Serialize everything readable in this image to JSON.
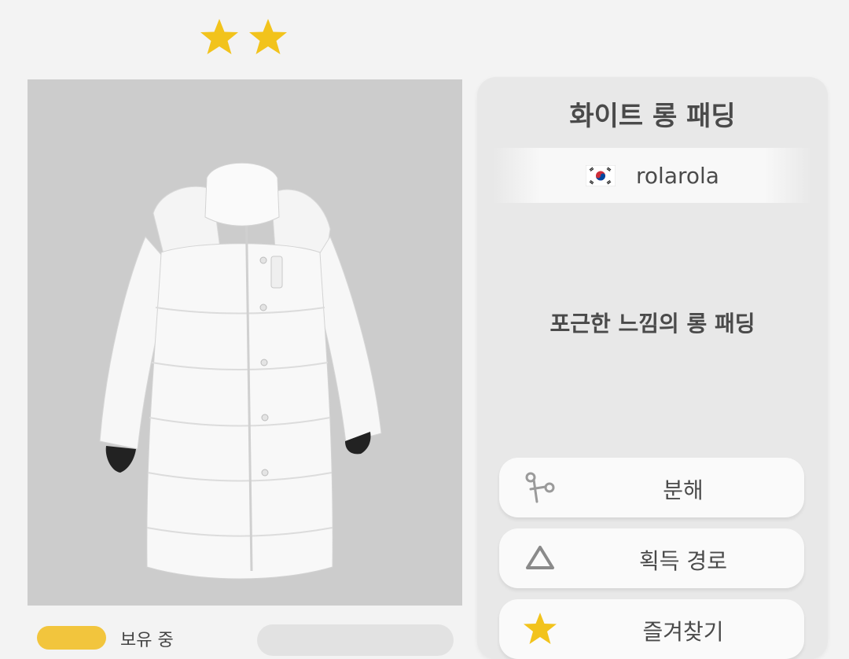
{
  "rarity_stars": 2,
  "item": {
    "name": "화이트 롱 패딩",
    "author": "rolarola",
    "author_country_flag": "korea-flag-icon",
    "description": "포근한 느낌의 롱 패딩"
  },
  "owned": {
    "label": "보유 중"
  },
  "actions": {
    "dismantle": "분해",
    "source": "획득 경로",
    "favorite": "즐겨찾기"
  },
  "colors": {
    "star": "#f2c31c",
    "preview_bg": "#cccccc",
    "panel_bg": "#e8e8e8",
    "button_bg": "#fafafa"
  }
}
